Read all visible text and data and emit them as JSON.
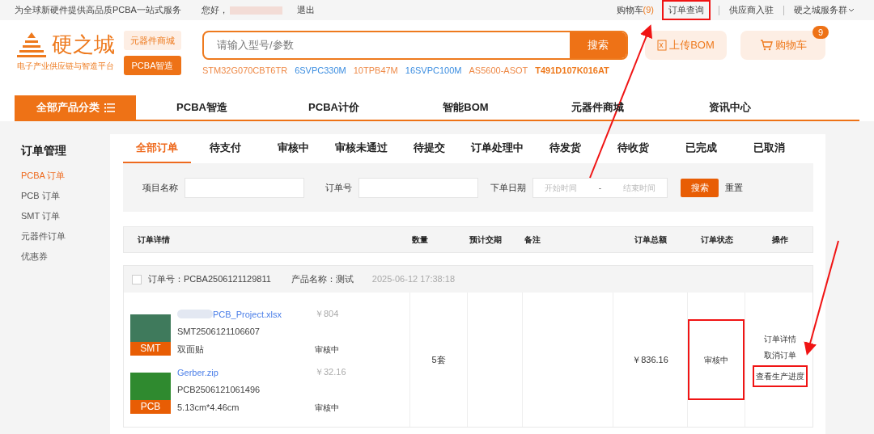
{
  "top_bar": {
    "slogan": "为全球新硬件提供高品质PCBA一站式服务",
    "greeting": "您好，",
    "logout": "退出",
    "links": [
      {
        "label": "购物车",
        "count": "(9)",
        "highlighted": false
      },
      {
        "label": "订单查询",
        "highlighted": true
      },
      {
        "label": "供应商入驻",
        "highlighted": false
      },
      {
        "label": "硬之城服务群",
        "highlighted": false,
        "dropdown": true
      }
    ]
  },
  "header": {
    "logo": {
      "name": "硬之城",
      "tagline": "电子产业供应链与智造平台"
    },
    "side_buttons": [
      {
        "label": "元器件商城",
        "selected": false
      },
      {
        "label": "PCBA智造",
        "selected": true
      }
    ],
    "search": {
      "placeholder": "请输入型号/参数",
      "button": "搜索"
    },
    "hot_keywords": [
      {
        "text": "STM32G070CBT6TR",
        "color": "#ee8a48",
        "bold": false
      },
      {
        "text": "6SVPC330M",
        "color": "#3b8de0",
        "bold": false
      },
      {
        "text": "10TPB47M",
        "color": "#ee8a48",
        "bold": false
      },
      {
        "text": "16SVPC100M",
        "color": "#3b8de0",
        "bold": false
      },
      {
        "text": "AS5600-ASOT",
        "color": "#ee8a48",
        "bold": false
      },
      {
        "text": "T491D107K016AT",
        "color": "#ee7a1e",
        "bold": true
      }
    ],
    "upload_bom": "上传BOM",
    "cart": {
      "label": "购物车",
      "badge": "9"
    }
  },
  "nav": {
    "all_categories": "全部产品分类",
    "items": [
      "PCBA智造",
      "PCBA计价",
      "智能BOM",
      "元器件商城",
      "资讯中心"
    ]
  },
  "sidebar": {
    "title": "订单管理",
    "items": [
      {
        "label": "PCBA 订单",
        "selected": true
      },
      {
        "label": "PCB 订单",
        "selected": false
      },
      {
        "label": "SMT 订单",
        "selected": false
      },
      {
        "label": "元器件订单",
        "selected": false
      },
      {
        "label": "优惠券",
        "selected": false
      }
    ]
  },
  "tabs": [
    {
      "label": "全部订单",
      "selected": true
    },
    {
      "label": "待支付",
      "selected": false
    },
    {
      "label": "审核中",
      "selected": false
    },
    {
      "label": "审核未通过",
      "selected": false
    },
    {
      "label": "待提交",
      "selected": false
    },
    {
      "label": "订单处理中",
      "selected": false
    },
    {
      "label": "待发货",
      "selected": false
    },
    {
      "label": "待收货",
      "selected": false
    },
    {
      "label": "已完成",
      "selected": false
    },
    {
      "label": "已取消",
      "selected": false
    }
  ],
  "filters": {
    "project_name": {
      "label": "项目名称"
    },
    "order_no": {
      "label": "订单号"
    },
    "order_date": {
      "label": "下单日期",
      "start_placeholder": "开始时间",
      "separator": "-",
      "end_placeholder": "结束时间"
    },
    "search": "搜索",
    "reset": "重置"
  },
  "table": {
    "columns": [
      "订单详情",
      "数量",
      "预计交期",
      "备注",
      "订单总额",
      "订单状态",
      "操作"
    ],
    "orders": [
      {
        "checked": false,
        "order_no_label": "订单号：",
        "order_no": "PCBA2506121129811",
        "product_label": "产品名称：",
        "product": "测试",
        "time": "2025-06-12 17:38:18",
        "items": [
          {
            "kind": "SMT",
            "badge": "SMT",
            "file": "PCB_Project.xlsx",
            "file_blurred": true,
            "code": "SMT2506121106607",
            "spec": "双面贴",
            "price": "￥804",
            "status": "审核中"
          },
          {
            "kind": "PCB",
            "badge": "PCB",
            "file": "Gerber.zip",
            "file_blurred": false,
            "code": "PCB2506121061496",
            "spec": "5.13cm*4.46cm",
            "price": "￥32.16",
            "status": "审核中"
          }
        ],
        "quantity": "5套",
        "total": "￥836.16",
        "status": "审核中",
        "status_highlighted": true,
        "actions": [
          {
            "label": "订单详情",
            "highlighted": false
          },
          {
            "label": "取消订单",
            "highlighted": false
          },
          {
            "label": "查看生产进度",
            "highlighted": true
          }
        ]
      }
    ]
  }
}
